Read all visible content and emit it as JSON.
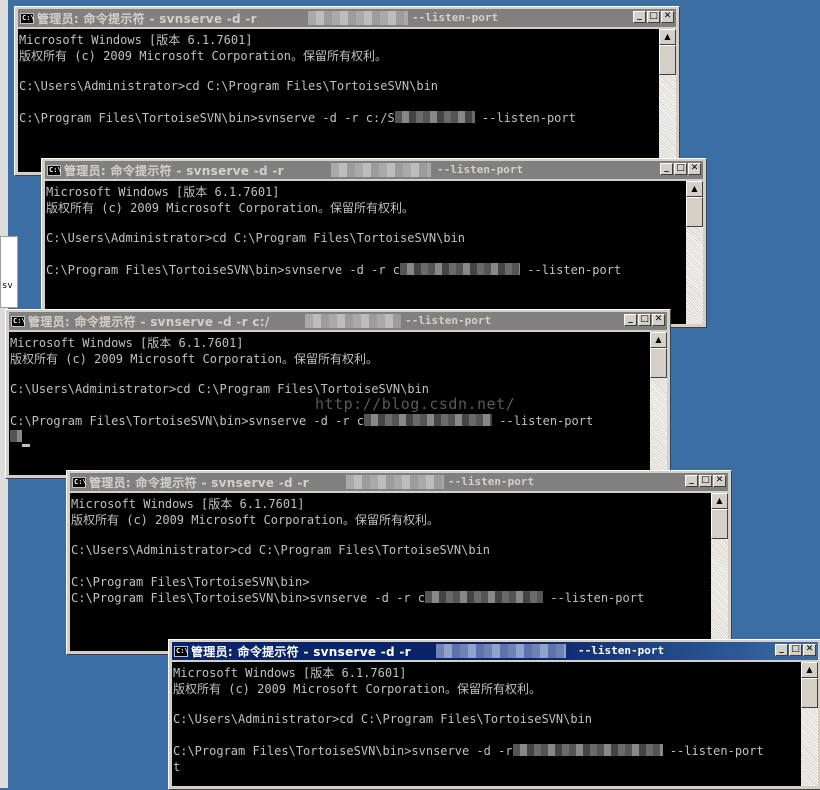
{
  "desktop": {
    "side_label": "sv"
  },
  "watermark": "http://blog.csdn.net/",
  "window_controls": {
    "minimize": "_",
    "maximize": "□",
    "close": "✕"
  },
  "scroll": {
    "up": "▲"
  },
  "icons": {
    "cmd": "C:\\"
  },
  "windows": [
    {
      "title_prefix": "管理员: 命令提示符 - svnserve  -d -r",
      "title_suffix": "--listen-port",
      "lines": [
        "Microsoft Windows [版本 6.1.7601]",
        "版权所有 (c) 2009 Microsoft Corporation。保留所有权利。",
        "",
        "C:\\Users\\Administrator>cd C:\\Program Files\\TortoiseSVN\\bin",
        "",
        "C:\\Program Files\\TortoiseSVN\\bin>svnserve -d -r c:/S",
        "--listen-port"
      ]
    },
    {
      "title_prefix": "管理员: 命令提示符 - svnserve  -d -r",
      "title_suffix": "--listen-port",
      "lines": [
        "Microsoft Windows [版本 6.1.7601]",
        "版权所有 (c) 2009 Microsoft Corporation。保留所有权利。",
        "",
        "C:\\Users\\Administrator>cd C:\\Program Files\\TortoiseSVN\\bin",
        "",
        "C:\\Program Files\\TortoiseSVN\\bin>svnserve -d -r c",
        "--listen-port"
      ]
    },
    {
      "title_prefix": "管理员: 命令提示符 - svnserve  -d -r c:/",
      "title_suffix": "--listen-port",
      "lines": [
        "Microsoft Windows [版本 6.1.7601]",
        "版权所有 (c) 2009 Microsoft Corporation。保留所有权利。",
        "",
        "C:\\Users\\Administrator>cd C:\\Program Files\\TortoiseSVN\\bin",
        "",
        "C:\\Program Files\\TortoiseSVN\\bin>svnserve -d -r c",
        "--listen-port"
      ]
    },
    {
      "title_prefix": "管理员: 命令提示符 - svnserve  -d -r",
      "title_suffix": "--listen-port",
      "lines": [
        "Microsoft Windows [版本 6.1.7601]",
        "版权所有 (c) 2009 Microsoft Corporation。保留所有权利。",
        "",
        "C:\\Users\\Administrator>cd C:\\Program Files\\TortoiseSVN\\bin",
        "",
        "C:\\Program Files\\TortoiseSVN\\bin>",
        "C:\\Program Files\\TortoiseSVN\\bin>svnserve -d -r c",
        "--listen-port"
      ]
    },
    {
      "title_prefix": "管理员: 命令提示符 - svnserve  -d -r",
      "title_suffix": "--listen-port",
      "lines": [
        "Microsoft Windows [版本 6.1.7601]",
        "版权所有 (c) 2009 Microsoft Corporation。保留所有权利。",
        "",
        "C:\\Users\\Administrator>cd C:\\Program Files\\TortoiseSVN\\bin",
        "",
        "C:\\Program Files\\TortoiseSVN\\bin>svnserve -d -r",
        "--listen-port",
        "t"
      ]
    }
  ]
}
